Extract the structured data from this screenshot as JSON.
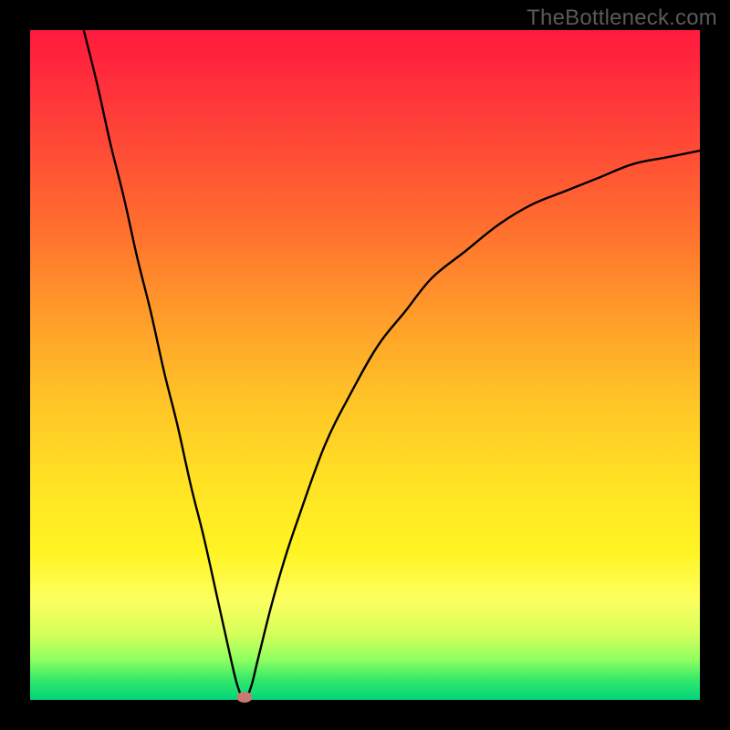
{
  "watermark": "TheBottleneck.com",
  "chart_data": {
    "type": "line",
    "title": "",
    "xlabel": "",
    "ylabel": "",
    "xlim": [
      0,
      100
    ],
    "ylim": [
      0,
      100
    ],
    "grid": false,
    "legend": false,
    "categories_note": "x is a normalized component-ratio axis (0–100); y is bottleneck % (0 = balanced at bottom, 100 = severe at top)",
    "series": [
      {
        "name": "bottleneck-curve",
        "x": [
          8,
          10,
          12,
          14,
          16,
          18,
          20,
          22,
          24,
          26,
          28,
          30,
          31,
          32,
          33,
          34,
          36,
          38,
          40,
          44,
          48,
          52,
          56,
          60,
          65,
          70,
          75,
          80,
          85,
          90,
          95,
          100
        ],
        "y": [
          100,
          92,
          83,
          75,
          66,
          58,
          49,
          41,
          32,
          24,
          15,
          6,
          2,
          0,
          2,
          6,
          14,
          21,
          27,
          38,
          46,
          53,
          58,
          63,
          67,
          71,
          74,
          76,
          78,
          80,
          81,
          82
        ]
      }
    ],
    "annotations": [
      {
        "name": "optimal-point",
        "x": 32,
        "y": 0
      }
    ],
    "background_gradient": {
      "orientation": "vertical",
      "stops": [
        {
          "pos": 0.0,
          "color": "#ff1a3d"
        },
        {
          "pos": 0.28,
          "color": "#ff6a2f"
        },
        {
          "pos": 0.55,
          "color": "#ffc327"
        },
        {
          "pos": 0.78,
          "color": "#fff423"
        },
        {
          "pos": 0.94,
          "color": "#8eff60"
        },
        {
          "pos": 1.0,
          "color": "#00d47b"
        }
      ]
    }
  }
}
